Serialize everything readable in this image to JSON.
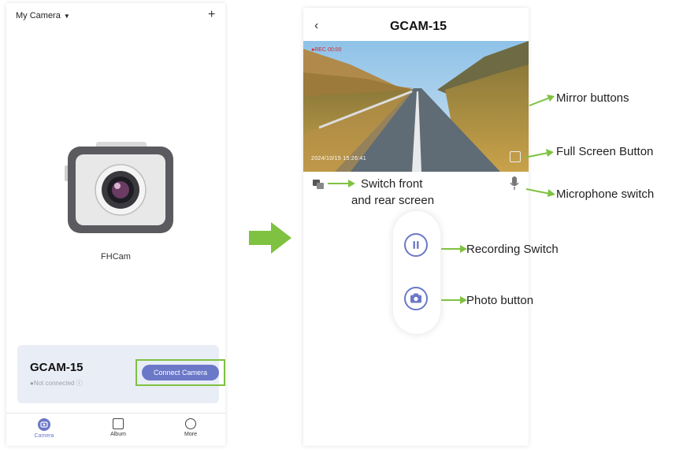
{
  "left_screen": {
    "camera_selector": "My Camera",
    "add_button": "+",
    "device_name": "FHCam",
    "card": {
      "name": "GCAM-15",
      "status": "●Not connected ⓘ",
      "connect_button": "Connect Camera"
    },
    "nav": [
      {
        "label": "Camera",
        "icon": "camera-icon"
      },
      {
        "label": "Album",
        "icon": "album-icon"
      },
      {
        "label": "More",
        "icon": "more-icon"
      }
    ]
  },
  "right_screen": {
    "back_icon": "‹",
    "title": "GCAM-15",
    "rec_text": "●REC 00:00",
    "timestamp": "2024/10/15 15:26:41"
  },
  "annotations": {
    "mirror": "Mirror buttons",
    "fullscreen": "Full Screen Button",
    "microphone": "Microphone switch",
    "switch_line1": "Switch front",
    "switch_line2": "and rear screen",
    "recording": "Recording Switch",
    "photo": "Photo button"
  },
  "colors": {
    "accent": "#6b78c8",
    "highlight": "#7fc241",
    "card_bg": "#e9edf6"
  }
}
